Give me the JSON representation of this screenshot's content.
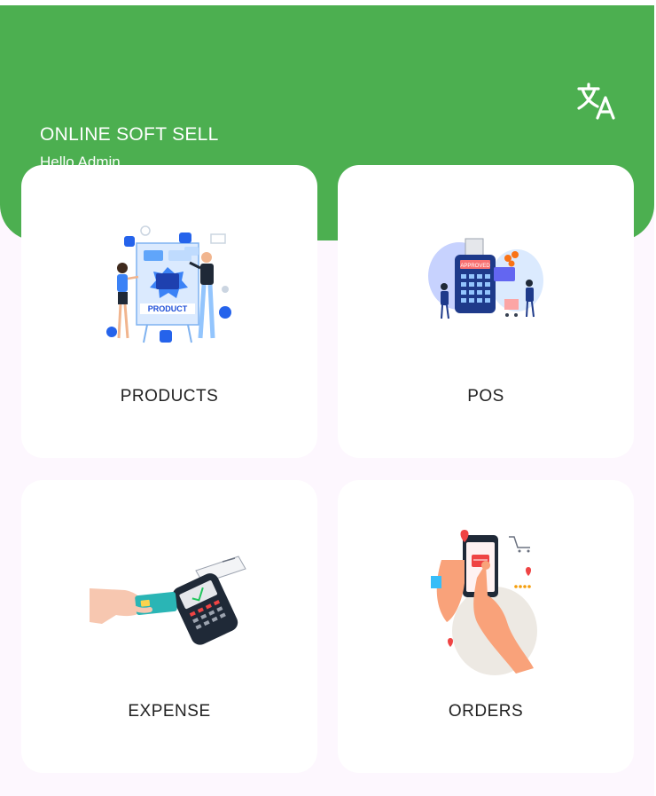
{
  "header": {
    "app_title": "ONLINE SOFT SELL",
    "greeting": "Hello Admin",
    "translate_icon": "translate-icon",
    "bg_color": "#4caf50"
  },
  "menu": {
    "items": [
      {
        "label": "PRODUCTS",
        "icon": "products-illustration"
      },
      {
        "label": "POS",
        "icon": "pos-terminal-illustration"
      },
      {
        "label": "EXPENSE",
        "icon": "card-payment-illustration"
      },
      {
        "label": "ORDERS",
        "icon": "mobile-shopping-illustration"
      }
    ]
  },
  "illustrations": {
    "products_banner": "PRODUCT",
    "pos_screen": "APPROVED"
  }
}
